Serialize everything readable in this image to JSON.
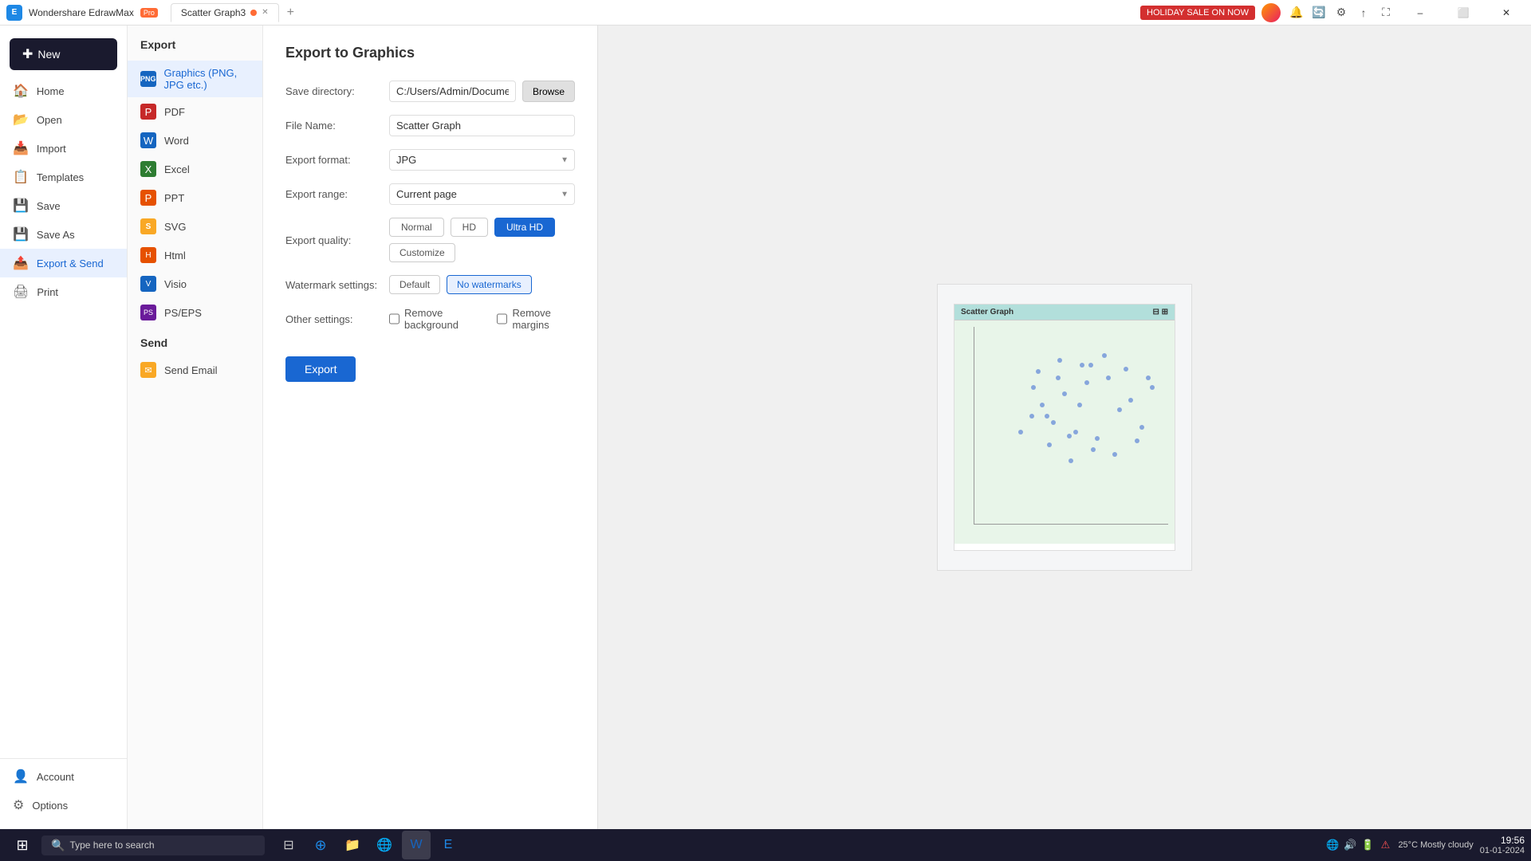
{
  "app": {
    "name": "Wondershare EdrawMax",
    "badge": "Pro",
    "logo_letter": "E"
  },
  "titlebar": {
    "tab_name": "Scatter Graph3",
    "holiday_btn": "HOLIDAY SALE ON NOW",
    "min_btn": "–",
    "max_btn": "⬜",
    "close_btn": "✕",
    "add_tab": "+"
  },
  "toolbar_icons": {
    "bell": "🔔",
    "update": "🔄",
    "settings": "⚙",
    "share": "↑",
    "fullscreen": "⛶"
  },
  "sidebar": {
    "new_label": "New",
    "items": [
      {
        "id": "home",
        "label": "Home",
        "icon": "🏠"
      },
      {
        "id": "open",
        "label": "Open",
        "icon": "📂"
      },
      {
        "id": "import",
        "label": "Import",
        "icon": "📥"
      },
      {
        "id": "templates",
        "label": "Templates",
        "icon": "📋"
      },
      {
        "id": "save",
        "label": "Save",
        "icon": "💾"
      },
      {
        "id": "save-as",
        "label": "Save As",
        "icon": "💾"
      },
      {
        "id": "export-send",
        "label": "Export & Send",
        "icon": "📤",
        "active": true
      },
      {
        "id": "print",
        "label": "Print",
        "icon": "🖨"
      }
    ],
    "bottom_items": [
      {
        "id": "account",
        "label": "Account",
        "icon": "👤"
      },
      {
        "id": "options",
        "label": "Options",
        "icon": "⚙"
      }
    ]
  },
  "export_panel": {
    "section_title": "Export",
    "items": [
      {
        "id": "graphics",
        "label": "Graphics (PNG, JPG etc.)",
        "icon": "PNG",
        "icon_class": "icon-png",
        "active": true
      },
      {
        "id": "pdf",
        "label": "PDF",
        "icon": "P",
        "icon_class": "icon-pdf"
      },
      {
        "id": "word",
        "label": "Word",
        "icon": "W",
        "icon_class": "icon-word"
      },
      {
        "id": "excel",
        "label": "Excel",
        "icon": "X",
        "icon_class": "icon-excel"
      },
      {
        "id": "ppt",
        "label": "PPT",
        "icon": "P",
        "icon_class": "icon-ppt"
      },
      {
        "id": "svg",
        "label": "SVG",
        "icon": "S",
        "icon_class": "icon-svg"
      },
      {
        "id": "html",
        "label": "Html",
        "icon": "H",
        "icon_class": "icon-html"
      },
      {
        "id": "visio",
        "label": "Visio",
        "icon": "V",
        "icon_class": "icon-visio"
      },
      {
        "id": "pseps",
        "label": "PS/EPS",
        "icon": "PS",
        "icon_class": "icon-pseps"
      }
    ],
    "send_title": "Send",
    "send_items": [
      {
        "id": "email",
        "label": "Send Email",
        "icon": "✉",
        "icon_class": "icon-email"
      }
    ]
  },
  "form": {
    "title": "Export to Graphics",
    "save_directory_label": "Save directory:",
    "save_directory_value": "C:/Users/Admin/Documents",
    "browse_label": "Browse",
    "file_name_label": "File Name:",
    "file_name_value": "Scatter Graph",
    "export_format_label": "Export format:",
    "export_format_value": "JPG",
    "export_range_label": "Export range:",
    "export_range_value": "Current page",
    "export_quality_label": "Export quality:",
    "quality_normal": "Normal",
    "quality_hd": "HD",
    "quality_ultra_hd": "Ultra HD",
    "customize_label": "Customize",
    "watermark_label": "Watermark settings:",
    "watermark_default": "Default",
    "watermark_no": "No watermarks",
    "other_settings_label": "Other settings:",
    "remove_background_label": "Remove background",
    "remove_margins_label": "Remove margins",
    "export_btn": "Export"
  },
  "preview": {
    "title": "Scatter Graph",
    "scatter_dots": [
      {
        "x": 35,
        "y": 55
      },
      {
        "x": 40,
        "y": 60
      },
      {
        "x": 45,
        "y": 52
      },
      {
        "x": 50,
        "y": 65
      },
      {
        "x": 55,
        "y": 48
      },
      {
        "x": 60,
        "y": 70
      },
      {
        "x": 65,
        "y": 45
      },
      {
        "x": 70,
        "y": 72
      },
      {
        "x": 75,
        "y": 58
      },
      {
        "x": 80,
        "y": 62
      },
      {
        "x": 85,
        "y": 50
      },
      {
        "x": 90,
        "y": 68
      },
      {
        "x": 38,
        "y": 75
      },
      {
        "x": 43,
        "y": 42
      },
      {
        "x": 48,
        "y": 80
      },
      {
        "x": 53,
        "y": 35
      },
      {
        "x": 58,
        "y": 78
      },
      {
        "x": 63,
        "y": 40
      },
      {
        "x": 68,
        "y": 82
      },
      {
        "x": 73,
        "y": 38
      },
      {
        "x": 78,
        "y": 76
      },
      {
        "x": 83,
        "y": 44
      },
      {
        "x": 88,
        "y": 72
      },
      {
        "x": 30,
        "y": 48
      },
      {
        "x": 36,
        "y": 68
      },
      {
        "x": 42,
        "y": 55
      },
      {
        "x": 47,
        "y": 72
      },
      {
        "x": 52,
        "y": 46
      },
      {
        "x": 57,
        "y": 60
      },
      {
        "x": 62,
        "y": 78
      }
    ]
  },
  "taskbar": {
    "search_placeholder": "Type here to search",
    "clock_time": "19:56",
    "clock_date": "01-01-2024",
    "weather": "25°C  Mostly cloudy"
  }
}
